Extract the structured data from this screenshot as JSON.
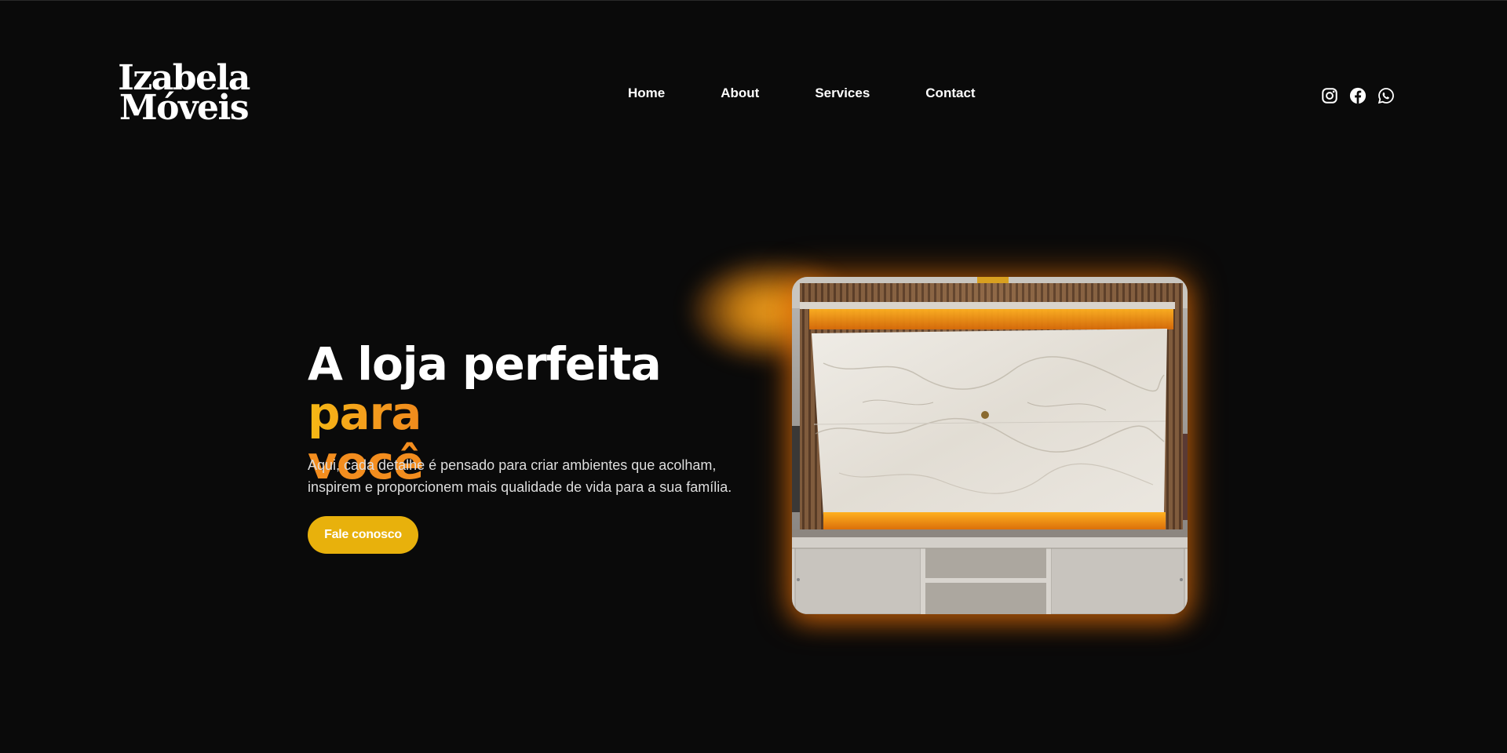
{
  "brand": {
    "line1": "Izabela",
    "line2": "Móveis"
  },
  "nav": {
    "items": [
      "Home",
      "About",
      "Services",
      "Contact"
    ]
  },
  "socials": [
    "instagram-icon",
    "facebook-icon",
    "whatsapp-icon"
  ],
  "hero": {
    "title_white": "A loja perfeita ",
    "title_accent_1": "para",
    "title_accent_2": "você",
    "description_line1": "Aqui, cada detalhe é pensado para criar ambientes que acolham,",
    "description_line2": "inspirem e proporcionem mais qualidade de vida para a sua família.",
    "cta_label": "Fale conosco"
  },
  "colors": {
    "background": "#0a0a0a",
    "accent_yellow": "#e8b10c",
    "accent_orange": "#f38d1e",
    "text": "#ffffff"
  }
}
